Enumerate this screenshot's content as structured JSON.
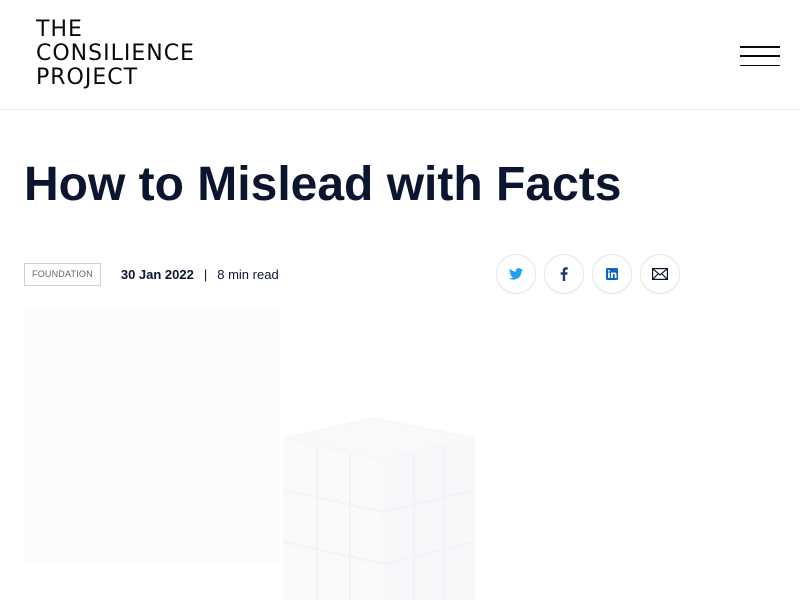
{
  "header": {
    "logo_lines": [
      "THE",
      "CONSILIENCE",
      "PROJECT"
    ],
    "menu_icon": "hamburger-menu-icon"
  },
  "article": {
    "title": "How to Mislead with Facts",
    "category": "FOUNDATION",
    "date": "30 Jan 2022",
    "separator": "|",
    "read_time": "8 min read"
  },
  "share": {
    "twitter_icon": "twitter-icon",
    "facebook_icon": "facebook-icon",
    "linkedin_icon": "linkedin-icon",
    "email_icon": "email-icon",
    "twitter_color": "#1da1f2",
    "facebook_color": "#1b3d6e",
    "linkedin_color": "#0a66c2",
    "email_color": "#0b1530"
  },
  "colors": {
    "title": "#0b1530",
    "border": "#ececec"
  }
}
